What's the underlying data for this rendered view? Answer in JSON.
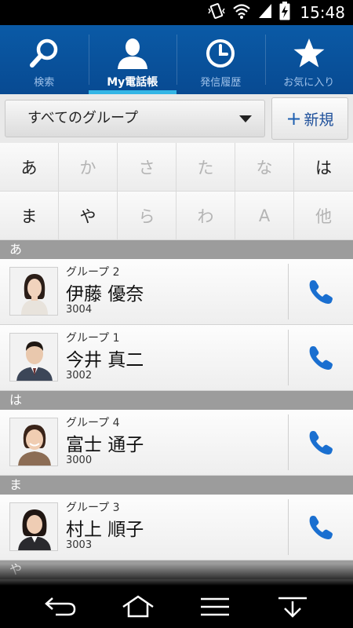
{
  "status_bar": {
    "time": "15:48",
    "icons": [
      "vibrate-icon",
      "wifi-icon",
      "signal-icon",
      "battery-charging-icon"
    ]
  },
  "nav_tabs": [
    {
      "label": "検索",
      "icon": "search-icon",
      "active": false
    },
    {
      "label": "My電話帳",
      "icon": "person-icon",
      "active": true
    },
    {
      "label": "発信履歴",
      "icon": "clock-icon",
      "active": false
    },
    {
      "label": "お気に入り",
      "icon": "star-icon",
      "active": false
    }
  ],
  "group_select": {
    "selected": "すべてのグループ",
    "new_button_label": "新規"
  },
  "kana_index": [
    {
      "label": "あ",
      "enabled": true
    },
    {
      "label": "か",
      "enabled": false
    },
    {
      "label": "さ",
      "enabled": false
    },
    {
      "label": "た",
      "enabled": false
    },
    {
      "label": "な",
      "enabled": false
    },
    {
      "label": "は",
      "enabled": true
    },
    {
      "label": "ま",
      "enabled": true
    },
    {
      "label": "や",
      "enabled": true
    },
    {
      "label": "ら",
      "enabled": false
    },
    {
      "label": "わ",
      "enabled": false
    },
    {
      "label": "A",
      "enabled": false
    },
    {
      "label": "他",
      "enabled": false
    }
  ],
  "sections": [
    {
      "header": "あ",
      "contacts": [
        {
          "group": "グループ 2",
          "name": "伊藤 優奈",
          "number": "3004"
        },
        {
          "group": "グループ 1",
          "name": "今井 真二",
          "number": "3002"
        }
      ]
    },
    {
      "header": "は",
      "contacts": [
        {
          "group": "グループ 4",
          "name": "富士 通子",
          "number": "3000"
        }
      ]
    },
    {
      "header": "ま",
      "contacts": [
        {
          "group": "グループ 3",
          "name": "村上 順子",
          "number": "3003"
        }
      ]
    },
    {
      "header": "や",
      "contacts": []
    }
  ],
  "bottom_nav": [
    "back-icon",
    "home-icon",
    "menu-icon",
    "notification-pull-icon"
  ],
  "colors": {
    "nav_bg": "#0a5aa6",
    "active_indicator": "#33b5e5",
    "call_icon": "#1a6fd0",
    "section_header": "#9c9c9c"
  }
}
